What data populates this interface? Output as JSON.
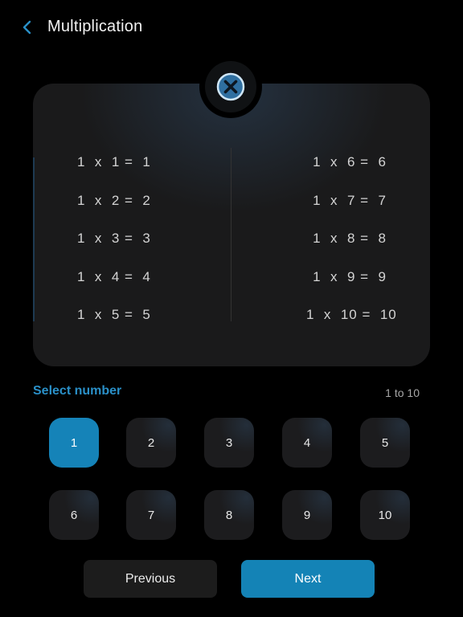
{
  "header": {
    "title": "Multiplication"
  },
  "table": {
    "left": [
      "1  x  1 =  1",
      "1  x  2 =  2",
      "1  x  3 =  3",
      "1  x  4 =  4",
      "1  x  5 =  5"
    ],
    "right": [
      "1  x  6 =  6",
      "1  x  7 =  7",
      "1  x  8 =  8",
      "1  x  9 =  9",
      "1  x  10 =  10"
    ]
  },
  "selector": {
    "label": "Select number",
    "range": "1 to 10",
    "numbers": [
      "1",
      "2",
      "3",
      "4",
      "5",
      "6",
      "7",
      "8",
      "9",
      "10"
    ],
    "selected": "1"
  },
  "nav": {
    "previous": "Previous",
    "next": "Next"
  },
  "icons": {
    "back": "chevron-left-icon",
    "close": "close-circle-icon"
  },
  "colors": {
    "accent": "#1583b8",
    "label_accent": "#2a90c8",
    "background": "#000000",
    "card": "#1a1a1b"
  }
}
